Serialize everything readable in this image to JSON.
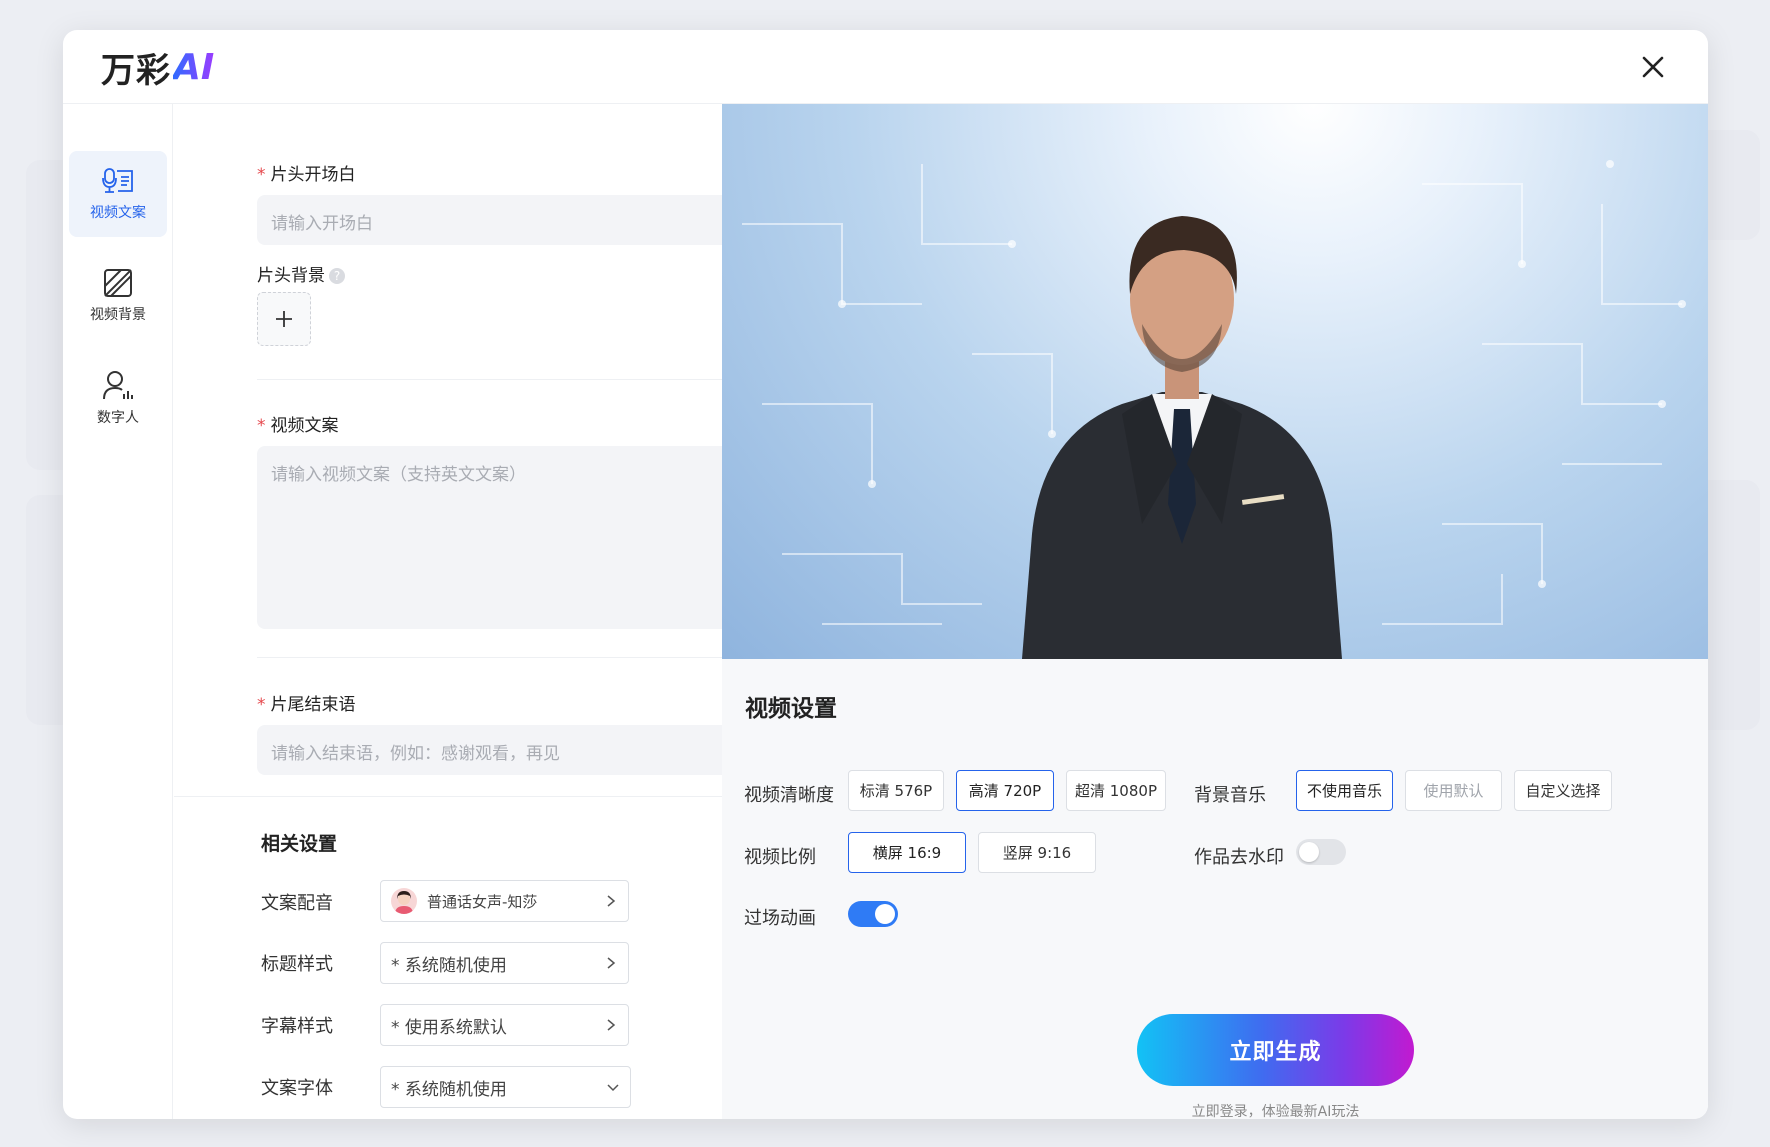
{
  "brand": {
    "name": "万彩",
    "ai": "AI"
  },
  "rail": {
    "items": [
      {
        "label": "视频文案",
        "active": true
      },
      {
        "label": "视频背景",
        "active": false
      },
      {
        "label": "数字人",
        "active": false
      }
    ]
  },
  "form": {
    "opening": {
      "label": "片头开场白",
      "placeholder": "请输入开场白"
    },
    "opening_bg": {
      "label": "片头背景",
      "help": "?"
    },
    "script": {
      "label": "视频文案",
      "placeholder": "请输入视频文案（支持英文文案）"
    },
    "ending": {
      "label": "片尾结束语",
      "placeholder": "请输入结束语，例如：感谢观看，再见"
    },
    "required_mark": "*"
  },
  "related": {
    "title": "相关设置",
    "rows": [
      {
        "label": "文案配音",
        "value": "普通话女声-知莎"
      },
      {
        "label": "标题样式",
        "value": "* 系统随机使用"
      },
      {
        "label": "字幕样式",
        "value": "* 使用系统默认"
      },
      {
        "label": "文案字体",
        "value": "* 系统随机使用"
      }
    ]
  },
  "video_settings": {
    "title": "视频设置",
    "resolution": {
      "label": "视频清晰度",
      "options": [
        "标清 576P",
        "高清 720P",
        "超清 1080P"
      ],
      "selected": "高清 720P"
    },
    "music": {
      "label": "背景音乐",
      "options": [
        "不使用音乐",
        "使用默认",
        "自定义选择"
      ],
      "selected": "不使用音乐"
    },
    "ratio": {
      "label": "视频比例",
      "options": [
        "横屏 16:9",
        "竖屏 9:16"
      ],
      "selected": "横屏 16:9"
    },
    "watermark": {
      "label": "作品去水印",
      "enabled": false
    },
    "transition": {
      "label": "过场动画",
      "enabled": true
    }
  },
  "generate": {
    "label": "立即生成",
    "hint": "立即登录，体验最新AI玩法"
  },
  "colors": {
    "accent": "#2563eb",
    "required": "#e5484d",
    "toggle_on": "#2f7bf5"
  }
}
